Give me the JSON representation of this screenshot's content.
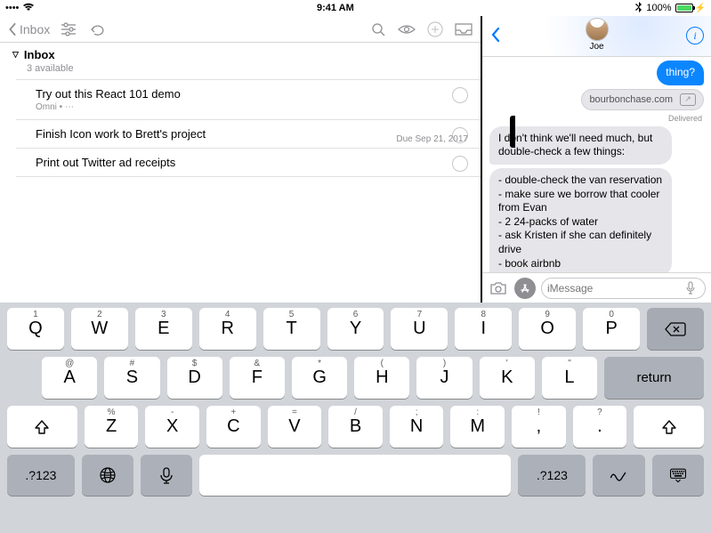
{
  "statusbar": {
    "signal": "●●●●●",
    "wifi": "wifi",
    "time": "9:41 AM",
    "bt": "bluetooth",
    "battery_pct": "100%",
    "charging": true
  },
  "mail": {
    "back_label": "Inbox",
    "section": {
      "title": "Inbox",
      "sub": "3 available"
    },
    "items": [
      {
        "title": "Try out this React 101 demo",
        "meta": "Omni • ⋯",
        "has_circle": true
      },
      {
        "title": "Finish Icon work to Brett's project",
        "meta": "",
        "due": "Due Sep 21, 2017",
        "has_circle": true
      },
      {
        "title": "Print out Twitter ad receipts",
        "meta": "",
        "has_circle": true
      }
    ]
  },
  "messages": {
    "contact_name": "Joe",
    "bubbles": {
      "blue_tail": "thing?",
      "link_text": "bourbonchase.com",
      "delivered": "Delivered",
      "gray1": "I don't think we'll need much, but double-check a few things:",
      "gray2": "- double-check the van reservation\n- make sure we borrow that cooler from Evan\n- 2 24-packs of water\n- ask Kristen if she can definitely drive\n- book airbnb"
    },
    "input_placeholder": "iMessage"
  },
  "keyboard": {
    "row1": [
      {
        "h": "1",
        "k": "Q"
      },
      {
        "h": "2",
        "k": "W"
      },
      {
        "h": "3",
        "k": "E"
      },
      {
        "h": "4",
        "k": "R"
      },
      {
        "h": "5",
        "k": "T"
      },
      {
        "h": "6",
        "k": "Y"
      },
      {
        "h": "7",
        "k": "U"
      },
      {
        "h": "8",
        "k": "I"
      },
      {
        "h": "9",
        "k": "O"
      },
      {
        "h": "0",
        "k": "P"
      }
    ],
    "row2": [
      {
        "h": "@",
        "k": "A"
      },
      {
        "h": "#",
        "k": "S"
      },
      {
        "h": "$",
        "k": "D"
      },
      {
        "h": "&",
        "k": "F"
      },
      {
        "h": "*",
        "k": "G"
      },
      {
        "h": "(",
        "k": "H"
      },
      {
        "h": ")",
        "k": "J"
      },
      {
        "h": "'",
        "k": "K"
      },
      {
        "h": "\"",
        "k": "L"
      }
    ],
    "row3": [
      {
        "h": "%",
        "k": "Z"
      },
      {
        "h": "-",
        "k": "X"
      },
      {
        "h": "+",
        "k": "C"
      },
      {
        "h": "=",
        "k": "V"
      },
      {
        "h": "/",
        "k": "B"
      },
      {
        "h": ";",
        "k": "N"
      },
      {
        "h": ":",
        "k": "M"
      },
      {
        "h": "!",
        "k": ","
      },
      {
        "h": "?",
        "k": "."
      }
    ],
    "return": "return",
    "symnum": ".?123"
  }
}
